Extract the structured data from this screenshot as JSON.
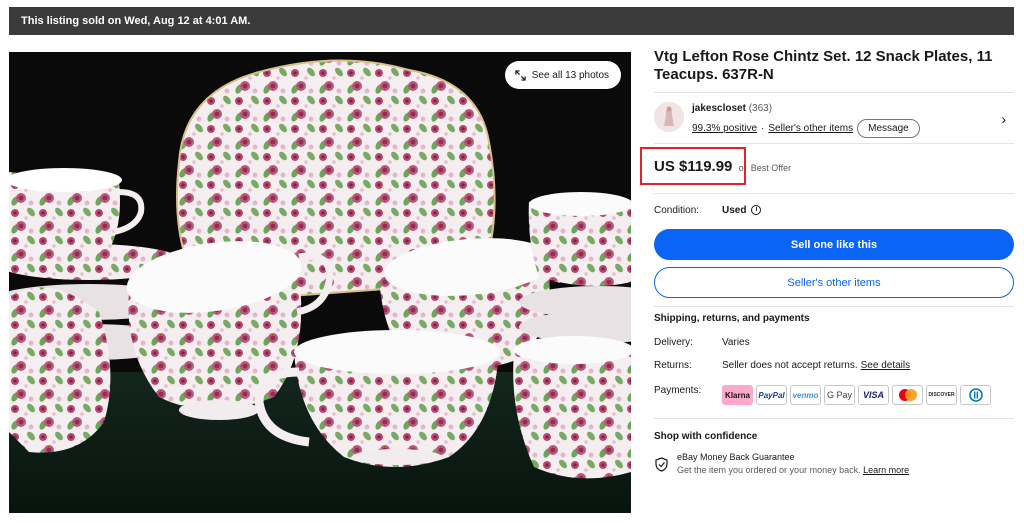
{
  "banner": {
    "text": "This listing sold on Wed, Aug 12 at 4:01 AM."
  },
  "gallery": {
    "see_all_label": "See all 13 photos"
  },
  "listing": {
    "title": "Vtg Lefton Rose Chintz Set. 12 Snack Plates, 11 Teacups. 637R-N"
  },
  "seller": {
    "name": "jakescloset",
    "feedback_count": "(363)",
    "positive": "99.3% positive",
    "separator": "·",
    "other_items_link": "Seller's other items",
    "message_label": "Message",
    "chevron": "›"
  },
  "price": {
    "amount": "US $119.99",
    "offer_prefix": "or",
    "offer_text": "Best Offer"
  },
  "condition": {
    "label": "Condition:",
    "value": "Used",
    "info_glyph": "i"
  },
  "actions": {
    "sell_label": "Sell one like this",
    "other_items_label": "Seller's other items"
  },
  "shipping": {
    "title": "Shipping, returns, and payments",
    "delivery_label": "Delivery:",
    "delivery_value": "Varies",
    "returns_label": "Returns:",
    "returns_value": "Seller does not accept returns.",
    "returns_link": "See details",
    "payments_label": "Payments:",
    "payment_methods": [
      "Klarna",
      "PayPal",
      "venmo",
      "G Pay",
      "VISA",
      "Mastercard",
      "DISCOVER",
      "Diners Club"
    ]
  },
  "confidence": {
    "title": "Shop with confidence",
    "guarantee_title": "eBay Money Back Guarantee",
    "guarantee_text": "Get the item you ordered or your money back.",
    "learn_more": "Learn more"
  },
  "colors": {
    "primary": "#0a64f5",
    "highlight": "#e0232a",
    "banner": "#3b3b3b"
  }
}
